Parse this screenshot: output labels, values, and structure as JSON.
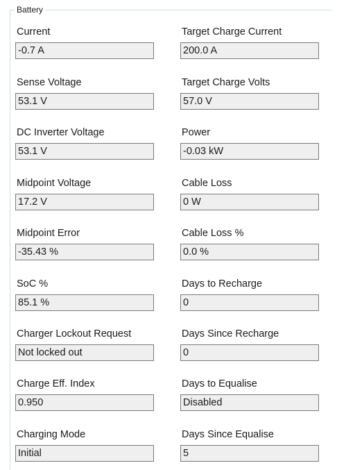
{
  "group": {
    "title": "Battery"
  },
  "fields": {
    "current": {
      "label": "Current",
      "value": "-0.7 A"
    },
    "target_charge_current": {
      "label": "Target Charge Current",
      "value": "200.0 A"
    },
    "sense_voltage": {
      "label": "Sense Voltage",
      "value": "53.1 V"
    },
    "target_charge_volts": {
      "label": "Target Charge Volts",
      "value": "57.0 V"
    },
    "dc_inverter_voltage": {
      "label": "DC Inverter Voltage",
      "value": "53.1 V"
    },
    "power": {
      "label": "Power",
      "value": "-0.03 kW"
    },
    "midpoint_voltage": {
      "label": "Midpoint Voltage",
      "value": "17.2 V"
    },
    "cable_loss": {
      "label": "Cable Loss",
      "value": "0 W"
    },
    "midpoint_error": {
      "label": "Midpoint Error",
      "value": "-35.43 %"
    },
    "cable_loss_pct": {
      "label": "Cable Loss %",
      "value": "0.0 %"
    },
    "soc_pct": {
      "label": "SoC %",
      "value": "85.1 %"
    },
    "days_to_recharge": {
      "label": "Days to Recharge",
      "value": "0"
    },
    "charger_lockout_request": {
      "label": "Charger Lockout Request",
      "value": "Not locked out"
    },
    "days_since_recharge": {
      "label": "Days Since Recharge",
      "value": "0"
    },
    "charge_eff_index": {
      "label": "Charge Eff. Index",
      "value": "0.950"
    },
    "days_to_equalise": {
      "label": "Days to Equalise",
      "value": "Disabled"
    },
    "charging_mode": {
      "label": "Charging Mode",
      "value": "Initial"
    },
    "days_since_equalise": {
      "label": "Days Since Equalise",
      "value": "5"
    }
  }
}
